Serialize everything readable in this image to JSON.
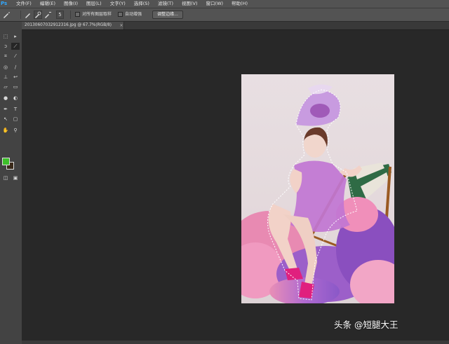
{
  "app": {
    "logo": "Ps"
  },
  "menu": {
    "items": [
      "文件(F)",
      "编辑(E)",
      "图像(I)",
      "图层(L)",
      "文字(Y)",
      "选择(S)",
      "滤镜(T)",
      "视图(V)",
      "窗口(W)",
      "帮助(H)"
    ]
  },
  "options": {
    "brush_size": "5",
    "sample_all_layers_label": "对所有图层取样",
    "auto_enhance_label": "自动增强",
    "refine_edge_label": "调整边缘..."
  },
  "document": {
    "tab_title": "20130607032912316.jpg @ 67.7%(RGB/8)",
    "close_glyph": "×"
  },
  "colors": {
    "foreground": "#3dbf2a",
    "background": "#3a2a1a",
    "selection_border": "#ffffff"
  },
  "icons": {
    "tool_icons": [
      "move-icon",
      "marquee-icon",
      "lasso-icon",
      "quick-selection-icon",
      "crop-icon",
      "eyedropper-icon",
      "healing-brush-icon",
      "brush-icon",
      "clone-stamp-icon",
      "history-brush-icon",
      "eraser-icon",
      "gradient-icon",
      "blur-icon",
      "dodge-icon",
      "pen-icon",
      "type-icon",
      "path-selection-icon",
      "shape-icon",
      "hand-icon",
      "zoom-icon"
    ]
  },
  "watermark": {
    "text": "头条 @短腿大王"
  }
}
